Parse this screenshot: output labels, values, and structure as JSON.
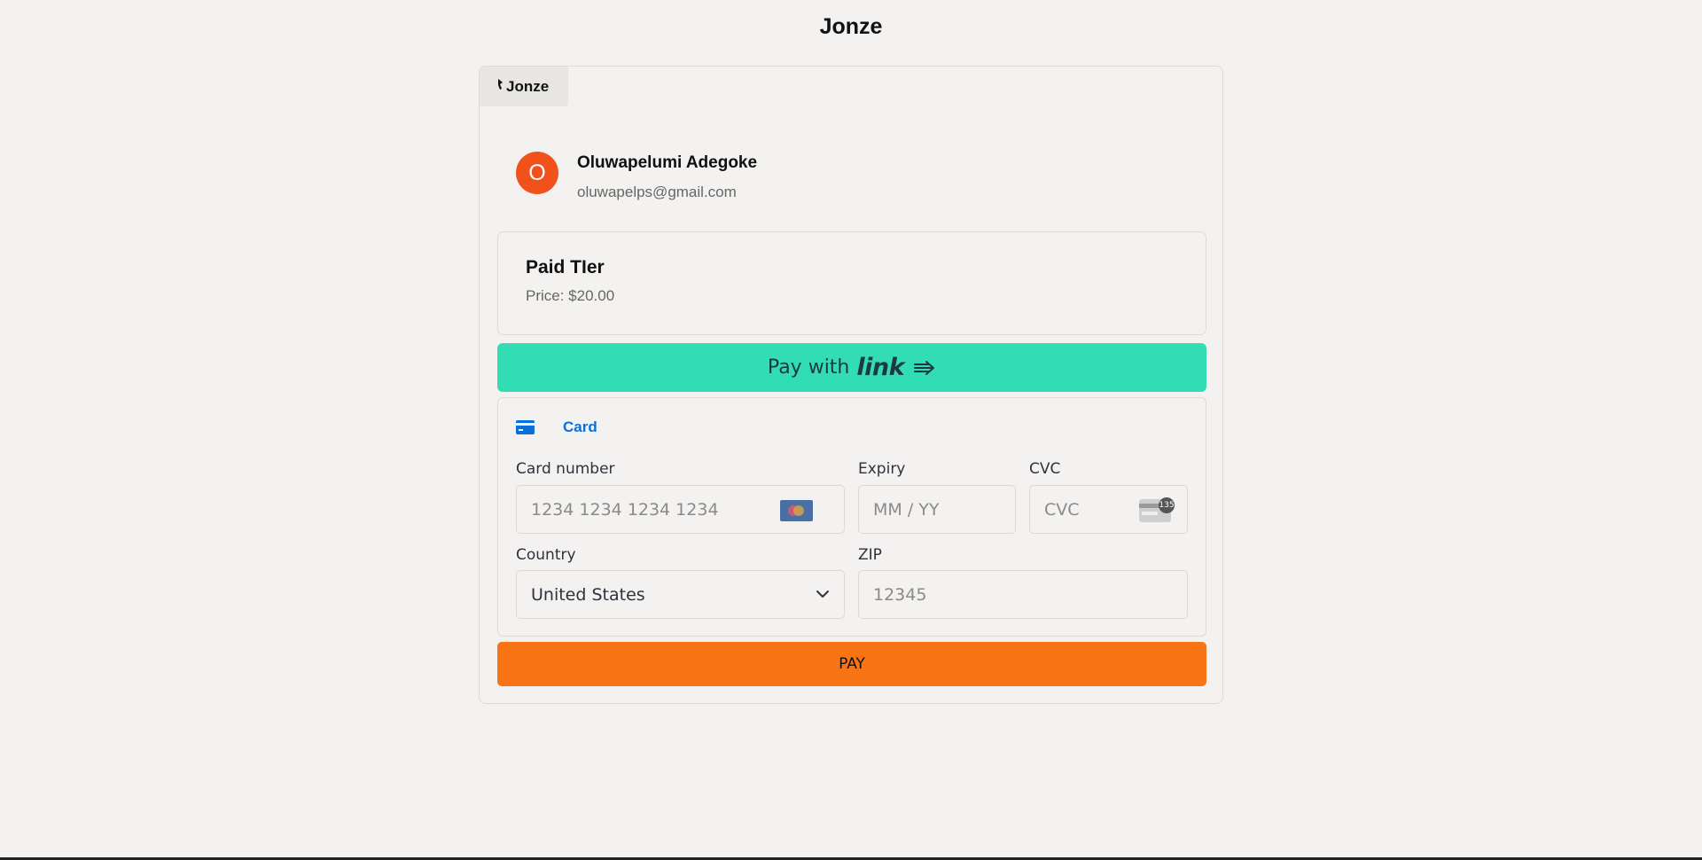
{
  "header": {
    "title": "Jonze"
  },
  "brand": {
    "name": "Jonze"
  },
  "user": {
    "initial": "O",
    "name": "Oluwapelumi Adegoke",
    "email": "oluwapelps@gmail.com"
  },
  "plan": {
    "name": "Paid TIer",
    "price": "Price: $20.00"
  },
  "link_pay": {
    "label": "Pay with",
    "brand": "link"
  },
  "payment": {
    "tab_label": "Card",
    "card_number": {
      "label": "Card number",
      "placeholder": "1234 1234 1234 1234"
    },
    "expiry": {
      "label": "Expiry",
      "placeholder": "MM / YY"
    },
    "cvc": {
      "label": "CVC",
      "placeholder": "CVC",
      "badge": "135"
    },
    "country": {
      "label": "Country",
      "value": "United States"
    },
    "zip": {
      "label": "ZIP",
      "placeholder": "12345"
    }
  },
  "pay_button": {
    "label": "PAY"
  },
  "colors": {
    "accent_orange": "#f97414",
    "link_green": "#33ddb3",
    "card_blue": "#0b6fd8",
    "avatar": "#f1511b"
  }
}
